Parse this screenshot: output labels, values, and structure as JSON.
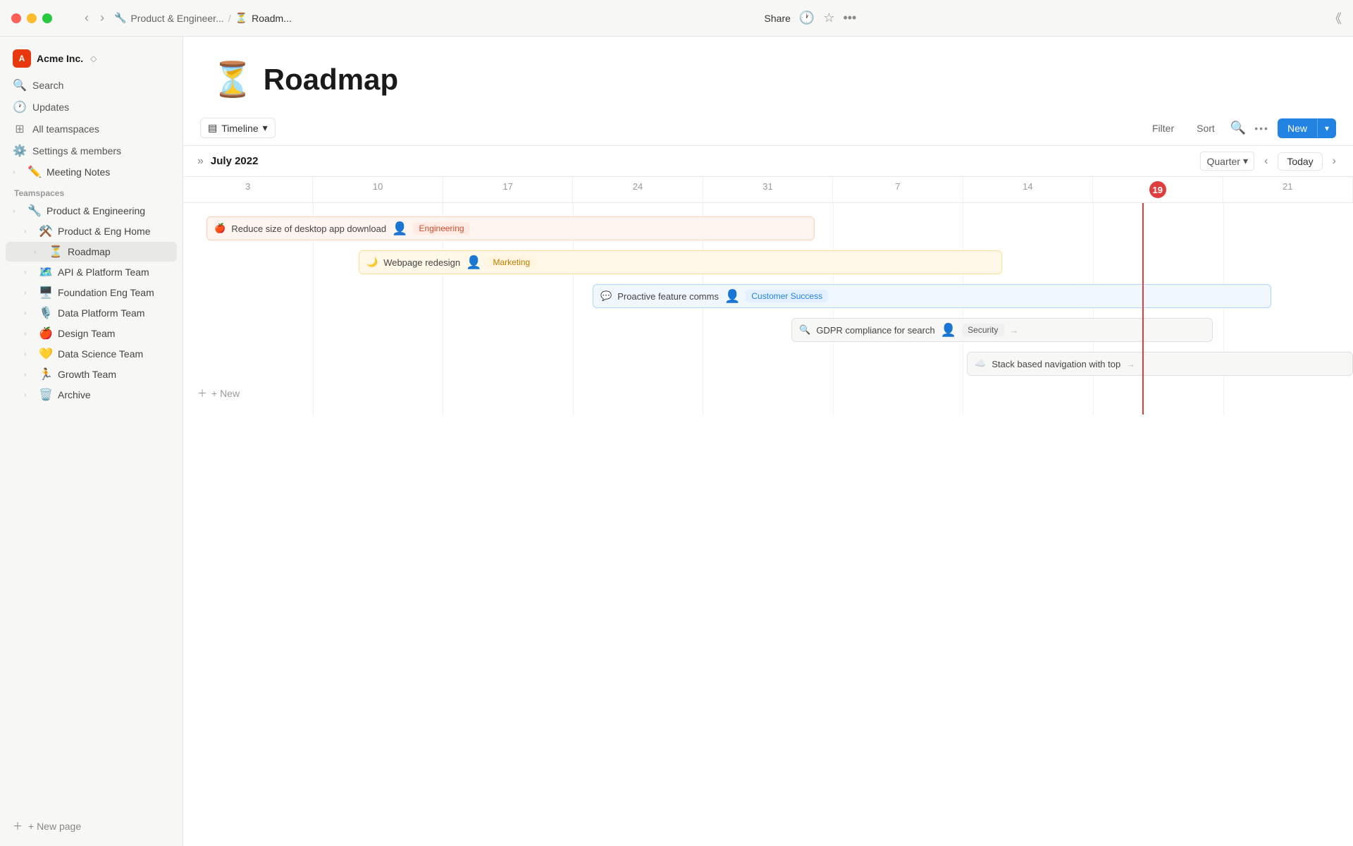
{
  "titlebar": {
    "workspace": {
      "logo": "A",
      "name": "Acme Inc.",
      "chevron": "◇"
    },
    "nav": {
      "back": "‹",
      "forward": "›",
      "breadcrumb_icon1": "🔧",
      "breadcrumb1": "Product & Engineer...",
      "separator": "/",
      "breadcrumb_icon2": "⏳",
      "breadcrumb2": "Roadm..."
    },
    "actions": {
      "share": "Share",
      "history": "🕐",
      "star": "☆",
      "more": "•••"
    }
  },
  "sidebar": {
    "nav_items": [
      {
        "id": "search",
        "icon": "🔍",
        "label": "Search"
      },
      {
        "id": "updates",
        "icon": "🕐",
        "label": "Updates"
      },
      {
        "id": "teamspaces",
        "icon": "⊞",
        "label": "All teamspaces"
      },
      {
        "id": "settings",
        "icon": "⚙️",
        "label": "Settings & members"
      }
    ],
    "pinned": [
      {
        "id": "meeting-notes",
        "icon": "✏️",
        "label": "Meeting Notes",
        "has_chevron": true
      }
    ],
    "section_label": "Teamspaces",
    "teamspaces": [
      {
        "id": "product-eng",
        "icon": "🔧",
        "label": "Product & Engineering",
        "has_chevron": true,
        "expanded": false
      },
      {
        "id": "product-eng-home",
        "icon": "⚒️",
        "label": "Product & Eng Home",
        "has_chevron": true,
        "expanded": false
      },
      {
        "id": "roadmap",
        "icon": "⏳",
        "label": "Roadmap",
        "has_chevron": true,
        "active": true
      },
      {
        "id": "api-platform",
        "icon": "🗺️",
        "label": "API & Platform Team",
        "has_chevron": true
      },
      {
        "id": "foundation-eng",
        "icon": "🖥️",
        "label": "Foundation Eng Team",
        "has_chevron": true
      },
      {
        "id": "data-platform",
        "icon": "🎙️",
        "label": "Data Platform Team",
        "has_chevron": true
      },
      {
        "id": "design",
        "icon": "🍎",
        "label": "Design Team",
        "has_chevron": true
      },
      {
        "id": "data-science",
        "icon": "💛",
        "label": "Data Science Team",
        "has_chevron": true
      },
      {
        "id": "growth",
        "icon": "🏃",
        "label": "Growth Team",
        "has_chevron": true
      },
      {
        "id": "archive",
        "icon": "🗑️",
        "label": "Archive",
        "has_chevron": true
      }
    ],
    "new_page": "+ New page"
  },
  "page": {
    "emoji": "⏳",
    "title": "Roadmap"
  },
  "toolbar": {
    "view_icon": "▤",
    "view_label": "Timeline",
    "view_chevron": "▾",
    "filter": "Filter",
    "sort": "Sort",
    "search_icon": "🔍",
    "more": "•••",
    "new_label": "New",
    "new_chevron": "▾"
  },
  "timeline": {
    "expand_icon": "»",
    "month": "July 2022",
    "quarter": "Quarter",
    "quarter_chevron": "▾",
    "prev": "‹",
    "today": "Today",
    "next": "›",
    "dates": [
      "3",
      "10",
      "17",
      "24",
      "31",
      "7",
      "14",
      "19",
      "21"
    ],
    "today_date": "19",
    "tasks": [
      {
        "id": "task1",
        "icon": "🍎",
        "label": "Reduce size of desktop app download",
        "avatar": "👤",
        "tag": "Engineering",
        "tag_class": "tag-engineering",
        "bar_style": "background:#fff5f0; border:1px solid #ffd0bc;",
        "left_pct": 2,
        "width_pct": 52
      },
      {
        "id": "task2",
        "icon": "🌙",
        "label": "Webpage redesign",
        "avatar": "👤",
        "tag": "Marketing",
        "tag_class": "tag-marketing",
        "bar_style": "background:#fff8e8; border:1px solid #ffe09a;",
        "left_pct": 15,
        "width_pct": 55
      },
      {
        "id": "task3",
        "icon": "💬",
        "label": "Proactive feature comms",
        "avatar": "👤",
        "tag": "Customer Success",
        "tag_class": "tag-customer",
        "bar_style": "background:#f0f7ff; border:1px solid #b3d4ff;",
        "left_pct": 35,
        "width_pct": 58
      },
      {
        "id": "task4",
        "icon": "🔍",
        "label": "GDPR compliance for search",
        "avatar": "👤",
        "tag": "Security",
        "tag_class": "tag-security",
        "bar_style": "background:#f7f7f5; border:1px solid #e0e0e0;",
        "left_pct": 52,
        "width_pct": 44,
        "has_arrow": true
      },
      {
        "id": "task5",
        "icon": "☁️",
        "label": "Stack based navigation with top",
        "avatar": "",
        "tag": "",
        "tag_class": "",
        "bar_style": "background:#f7f7f5; border:1px solid #e0e0e0;",
        "left_pct": 68,
        "width_pct": 32,
        "has_arrow": true,
        "truncated": true
      }
    ],
    "new_label": "+ New"
  }
}
